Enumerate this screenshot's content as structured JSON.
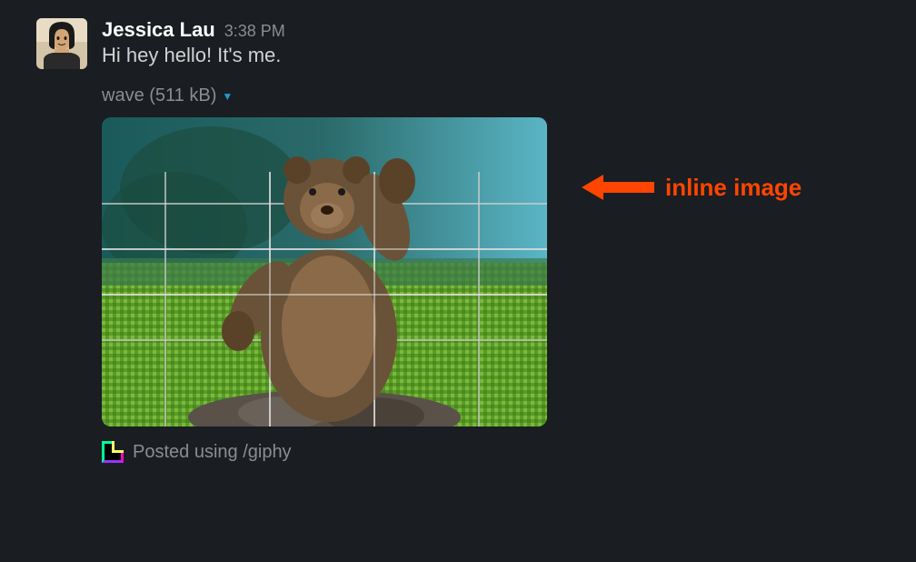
{
  "message": {
    "username": "Jessica Lau",
    "timestamp": "3:38 PM",
    "text": "Hi hey hello! It's me.",
    "attachment": {
      "name": "wave",
      "size": "511 kB",
      "full_label": "wave (511 kB)"
    },
    "footer": "Posted using /giphy"
  },
  "annotation": {
    "label": "inline image"
  },
  "colors": {
    "background": "#1a1d21",
    "text_primary": "#ffffff",
    "text_secondary": "#d1d2d3",
    "text_muted": "#8a8d91",
    "link": "#1d9bd1",
    "annotation": "#ff4500"
  }
}
